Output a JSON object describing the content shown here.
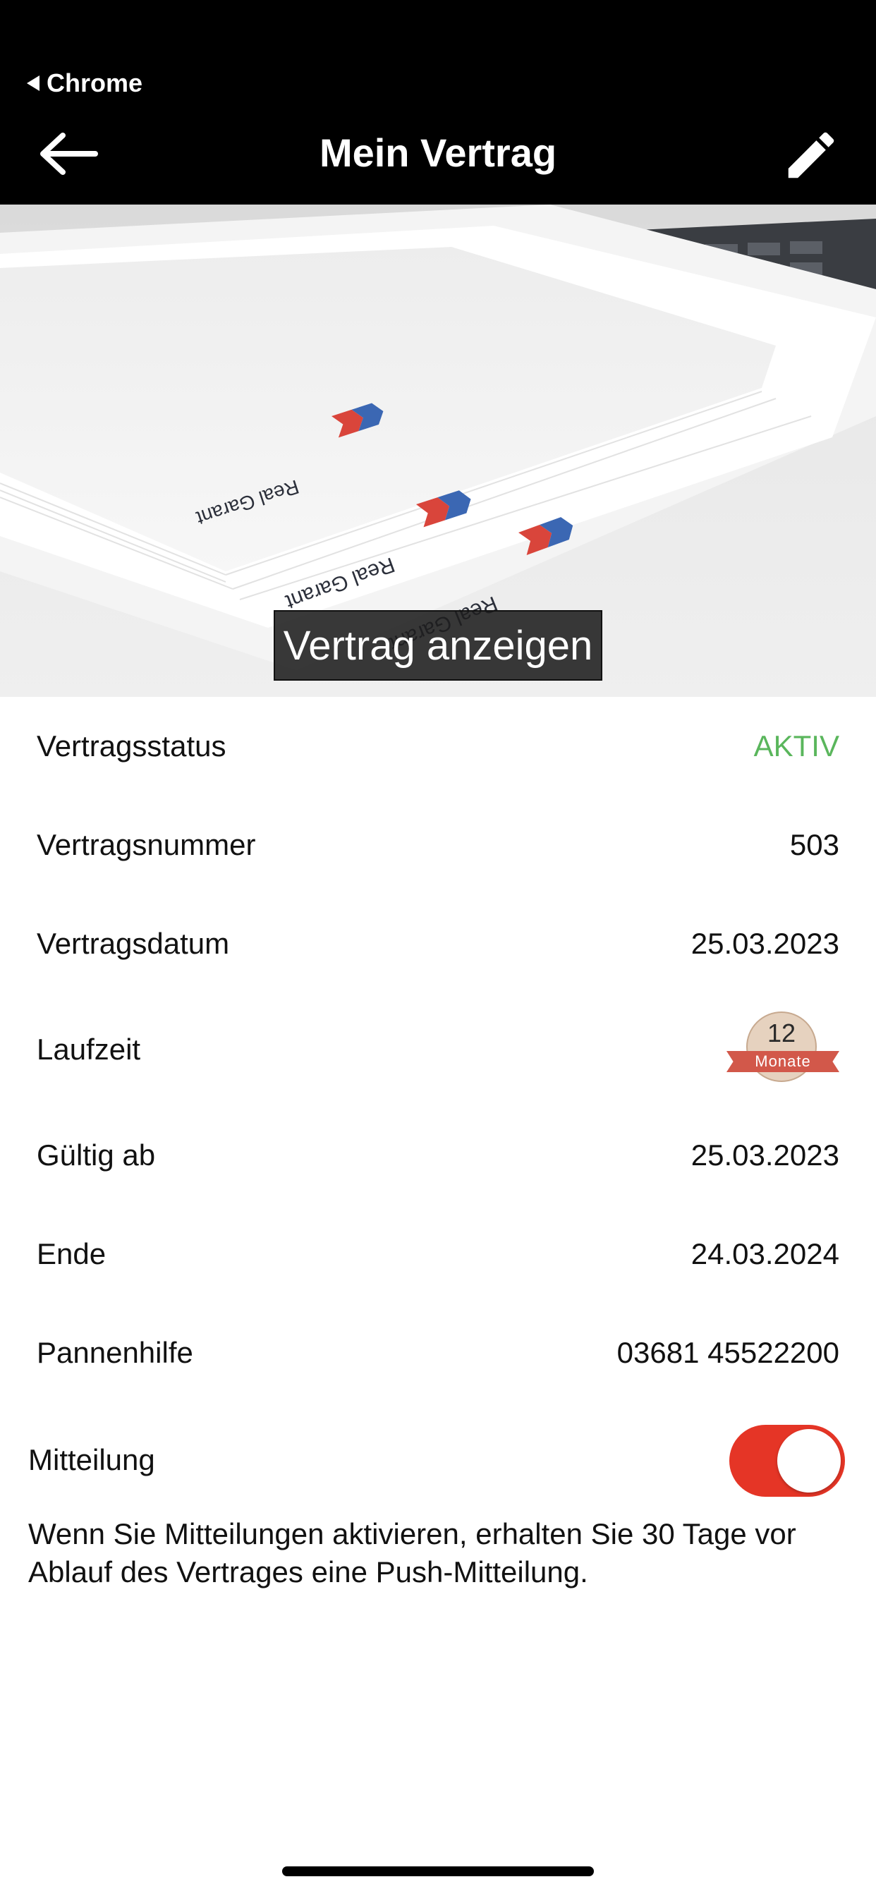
{
  "header": {
    "back_app_label": "Chrome",
    "title": "Mein Vertrag"
  },
  "hero": {
    "button_label": "Vertrag anzeigen",
    "image_brand_text": "Real Garant"
  },
  "details": [
    {
      "label": "Vertragsstatus",
      "value": "AKTIV"
    },
    {
      "label": "Vertragsnummer",
      "value": "503"
    },
    {
      "label": "Vertragsdatum",
      "value": "25.03.2023"
    },
    {
      "label": "Laufzeit",
      "value": ""
    },
    {
      "label": "Gültig ab",
      "value": "25.03.2023"
    },
    {
      "label": "Ende",
      "value": "24.03.2024"
    },
    {
      "label": "Pannenhilfe",
      "value": "03681 45522200"
    }
  ],
  "duration_badge": {
    "number": "12",
    "unit": "Monate"
  },
  "notification": {
    "label": "Mitteilung",
    "enabled": true,
    "description": "Wenn Sie Mitteilungen aktivieren, erhalten Sie 30 Tage vor Ablauf des Vertrages eine Push-Mitteilung."
  },
  "colors": {
    "header_bg": "#000000",
    "status_active": "#5ab65c",
    "toggle_on": "#e53526",
    "badge_ribbon": "#d2584a"
  },
  "icons": {
    "back": "arrow-left-icon",
    "edit": "pencil-icon",
    "back_app": "triangle-left-icon"
  }
}
